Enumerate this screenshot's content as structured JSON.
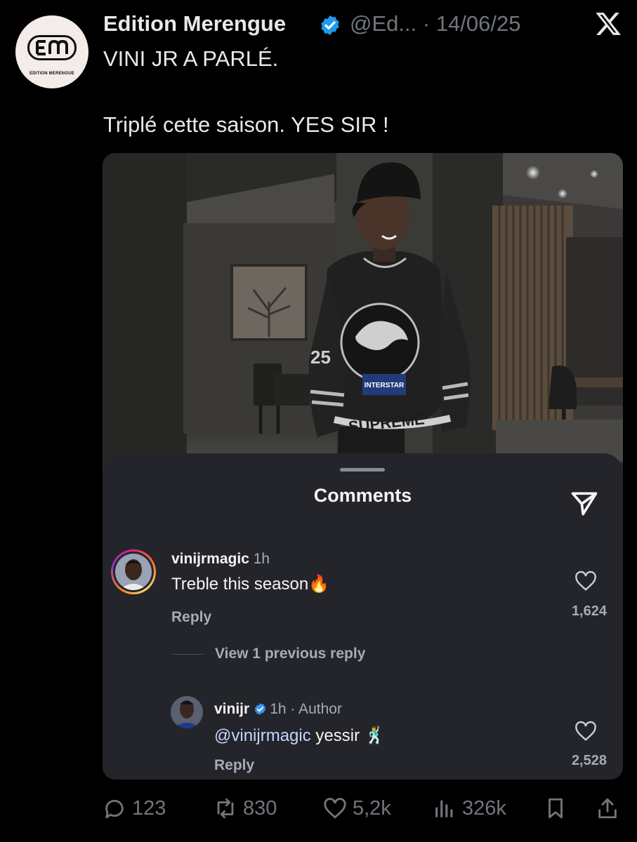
{
  "tweet": {
    "author_name": "Edition Merengue",
    "handle": "@Ed...",
    "date_separator": "·",
    "date": "14/06/25",
    "avatar_monogram": "EM",
    "avatar_caption": "EDITION MERENGUE",
    "text_line1": "VINI JR A PARLÉ.",
    "text_line2": "Triplé cette saison. YES SIR !"
  },
  "photo": {
    "jersey_sponsor": "INTERSTAR",
    "jersey_wordmark": "SUPREME",
    "jersey_number": "25"
  },
  "comments_sheet": {
    "title": "Comments",
    "comments": [
      {
        "username": "vinijrmagic",
        "time": "1h",
        "text": "Treble this season",
        "emoji": "🔥",
        "reply_label": "Reply",
        "likes": "1,624"
      }
    ],
    "view_previous": "View 1 previous reply",
    "replies": [
      {
        "username": "vinijr",
        "time": "1h",
        "author_tag": "· Author",
        "mention": "@vinijrmagic",
        "text": " yessir",
        "emoji": "🕺",
        "reply_label": "Reply",
        "likes": "2,528"
      }
    ]
  },
  "actions": {
    "replies": "123",
    "reposts": "830",
    "likes": "5,2k",
    "views": "326k"
  },
  "colors": {
    "background": "#000000",
    "verified": "#1d9bf0",
    "muted": "#71767b",
    "sheet": "#23252b"
  }
}
